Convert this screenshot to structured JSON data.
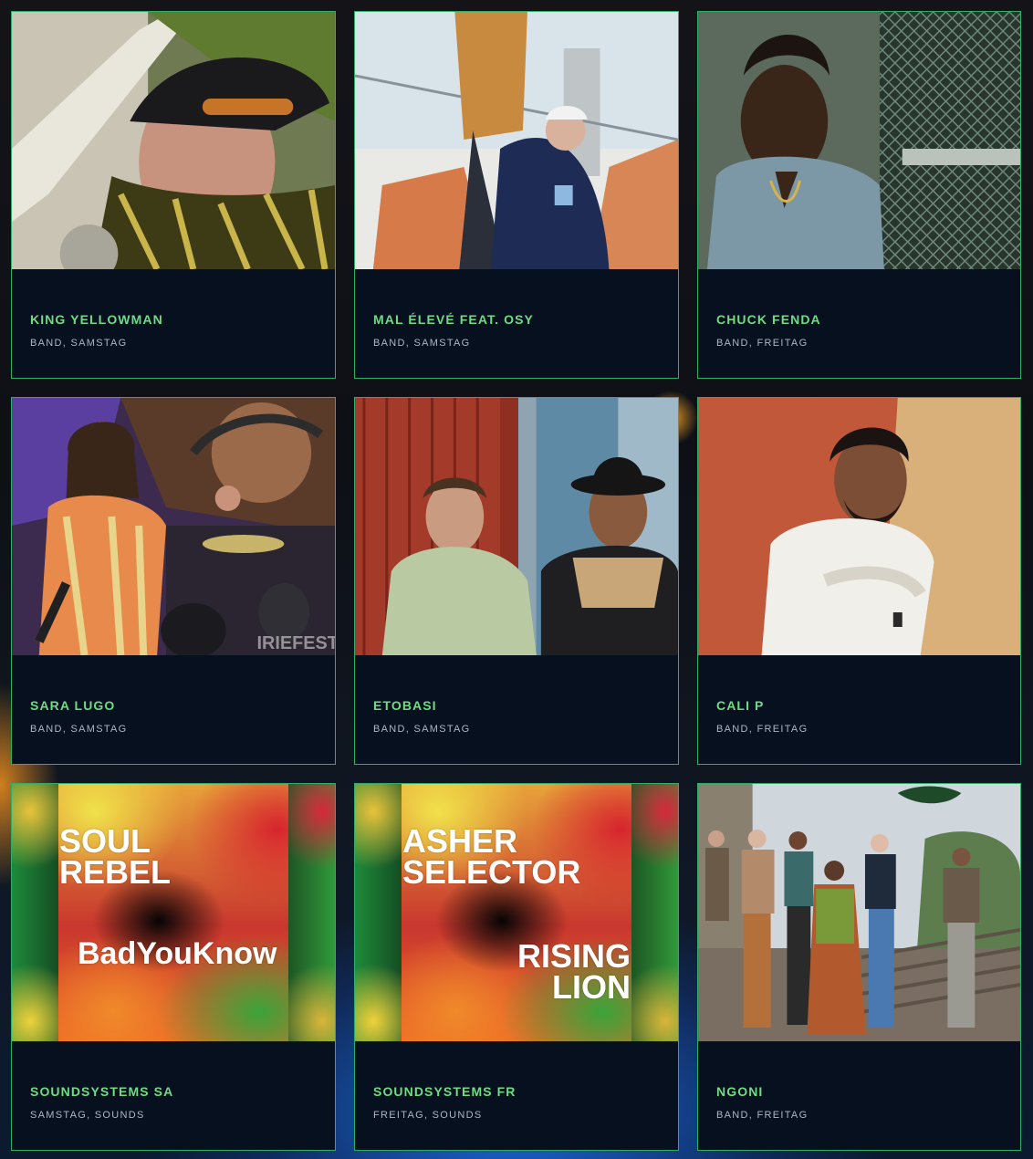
{
  "artists": [
    {
      "name": "KING YELLOWMAN",
      "meta": "BAND, SAMSTAG"
    },
    {
      "name": "MAL ÉLEVÉ FEAT. OSY",
      "meta": "BAND, SAMSTAG"
    },
    {
      "name": "CHUCK FENDA",
      "meta": "BAND, FREITAG"
    },
    {
      "name": "SARA LUGO",
      "meta": "BAND, SAMSTAG"
    },
    {
      "name": "ETOBASI",
      "meta": "BAND, SAMSTAG"
    },
    {
      "name": "CALI P",
      "meta": "BAND, FREITAG"
    },
    {
      "name": "SOUNDSYSTEMS SA",
      "meta": "SAMSTAG, SOUNDS"
    },
    {
      "name": "SOUNDSYSTEMS FR",
      "meta": "FREITAG, SOUNDS"
    },
    {
      "name": "NGONI",
      "meta": "BAND, FREITAG"
    }
  ],
  "posters": {
    "sa": {
      "top_line1": "SOUL",
      "top_line2": "REBEL",
      "bottom": "BadYouKnow"
    },
    "fr": {
      "top_line1": "ASHER",
      "top_line2": "SELECTOR",
      "bottom_line1": "RISING",
      "bottom_line2": "LION"
    }
  },
  "watermark": "IRIEFEST"
}
